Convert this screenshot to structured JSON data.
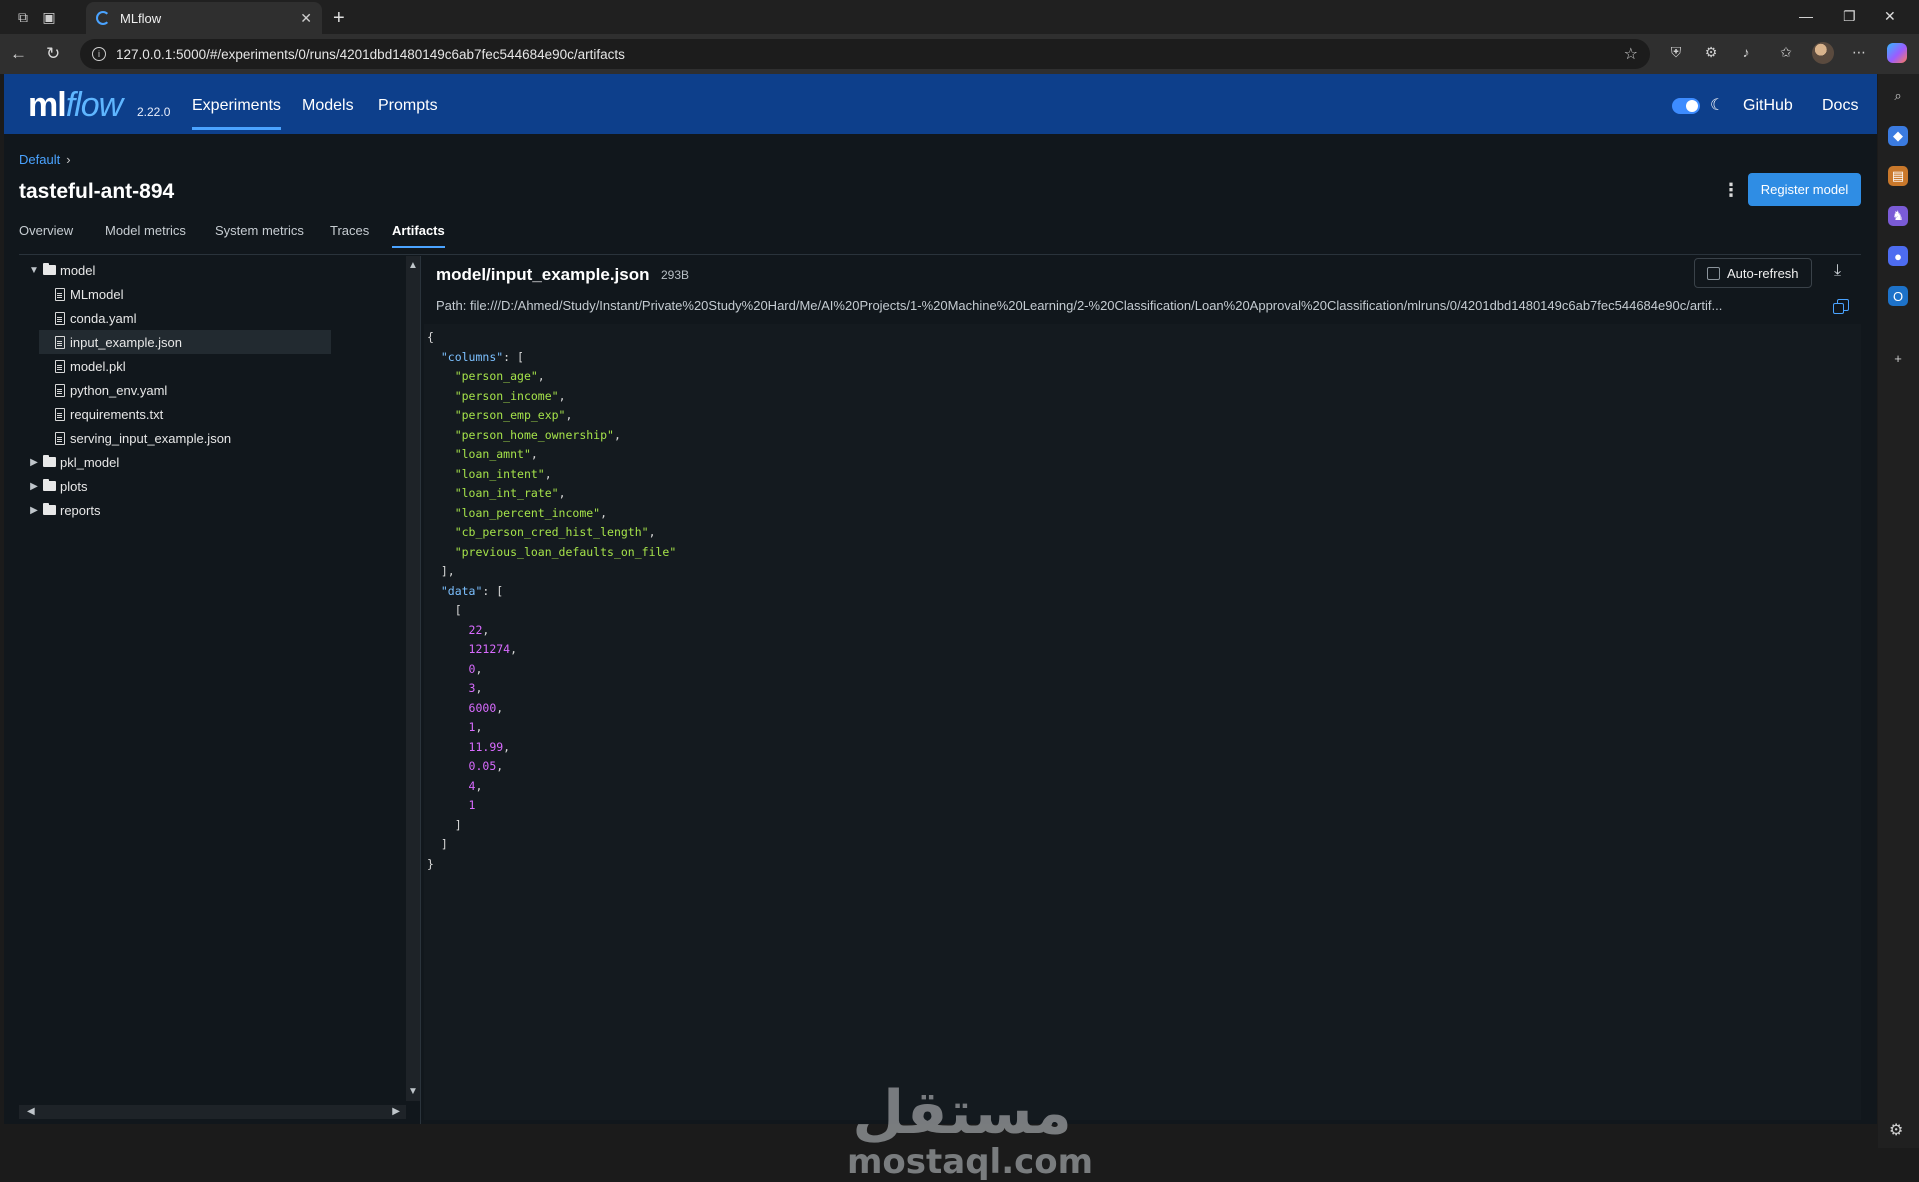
{
  "browser": {
    "tab_title": "MLflow",
    "url": "127.0.0.1:5000/#/experiments/0/runs/4201dbd1480149c6ab7fec544684e90c/artifacts"
  },
  "header": {
    "logo_ml": "ml",
    "logo_flow": "flow",
    "version": "2.22.0",
    "nav": [
      "Experiments",
      "Models",
      "Prompts"
    ],
    "links": [
      "GitHub",
      "Docs"
    ]
  },
  "page": {
    "breadcrumb": "Default",
    "title": "tasteful-ant-894",
    "register_button": "Register model",
    "tabs": [
      "Overview",
      "Model metrics",
      "System metrics",
      "Traces",
      "Artifacts"
    ],
    "active_tab": "Artifacts"
  },
  "tree": {
    "folders_open": "model",
    "model_files": [
      "MLmodel",
      "conda.yaml",
      "input_example.json",
      "model.pkl",
      "python_env.yaml",
      "requirements.txt",
      "serving_input_example.json"
    ],
    "selected_file": "input_example.json",
    "other_folders": [
      "pkl_model",
      "plots",
      "reports"
    ]
  },
  "viewer": {
    "file_title": "model/input_example.json",
    "file_size": "293B",
    "auto_refresh_label": "Auto-refresh",
    "path": "Path: file:///D:/Ahmed/Study/Instant/Private%20Study%20Hard/Me/AI%20Projects/1-%20Machine%20Learning/2-%20Classification/Loan%20Approval%20Classification/mlruns/0/4201dbd1480149c6ab7fec544684e90c/artif...",
    "columns": [
      "person_age",
      "person_income",
      "person_emp_exp",
      "person_home_ownership",
      "loan_amnt",
      "loan_intent",
      "loan_int_rate",
      "loan_percent_income",
      "cb_person_cred_hist_length",
      "previous_loan_defaults_on_file"
    ],
    "data": [
      "22",
      "121274",
      "0",
      "3",
      "6000",
      "1",
      "11.99",
      "0.05",
      "4",
      "1"
    ]
  },
  "watermark": {
    "arabic": "مستقل",
    "latin": "mostaql.com"
  },
  "colors": {
    "header_bg": "#0d3f8b",
    "accent": "#4aa3ff",
    "json_key": "#7cc0ff",
    "json_string": "#a5e24a",
    "json_number": "#d96bff"
  }
}
